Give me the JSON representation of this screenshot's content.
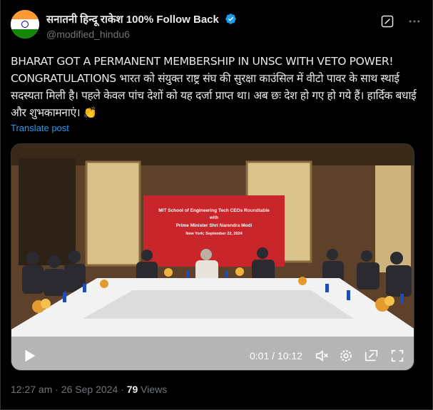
{
  "author": {
    "display_name": "सनातनी हिन्दू राकेश 100% Follow Back",
    "handle": "@modified_hindu6",
    "verified": true,
    "avatar_icon": "india-flag-avatar"
  },
  "post": {
    "text": "BHARAT GOT A PERMANENT MEMBERSHIP IN UNSC WITH VETO POWER! CONGRATULATIONS भारत को संयुक्त राष्ट्र संघ की सुरक्षा काउंसिल में वीटो पावर के साथ स्थाई सदस्यता मिली है। पहले केवल पांच देशों को यह दर्जा प्राप्त था। अब छः देश हो गए  हो गये हैं। हार्दिक बधाई और शुभकामनाएं। 👏",
    "translate_label": "Translate post"
  },
  "video": {
    "banner_line1": "MIT School of Engineering Tech CEOs Roundtable",
    "banner_line2": "with",
    "banner_line3": "Prime Minister Shri Narendra Modi",
    "banner_line4": "New York; September 22, 2024",
    "timecode": "0:01 / 10:12",
    "controls": [
      "play-icon",
      "volume-icon",
      "settings-icon",
      "pip-icon",
      "fullscreen-icon"
    ]
  },
  "meta": {
    "time": "12:27 am",
    "separator": "·",
    "date": "26 Sep 2024",
    "views_count": "79",
    "views_label": "Views"
  },
  "colors": {
    "background": "#000000",
    "text": "#e7e9ea",
    "secondary": "#71767b",
    "link": "#1d9bf0",
    "banner": "#c8262a"
  }
}
